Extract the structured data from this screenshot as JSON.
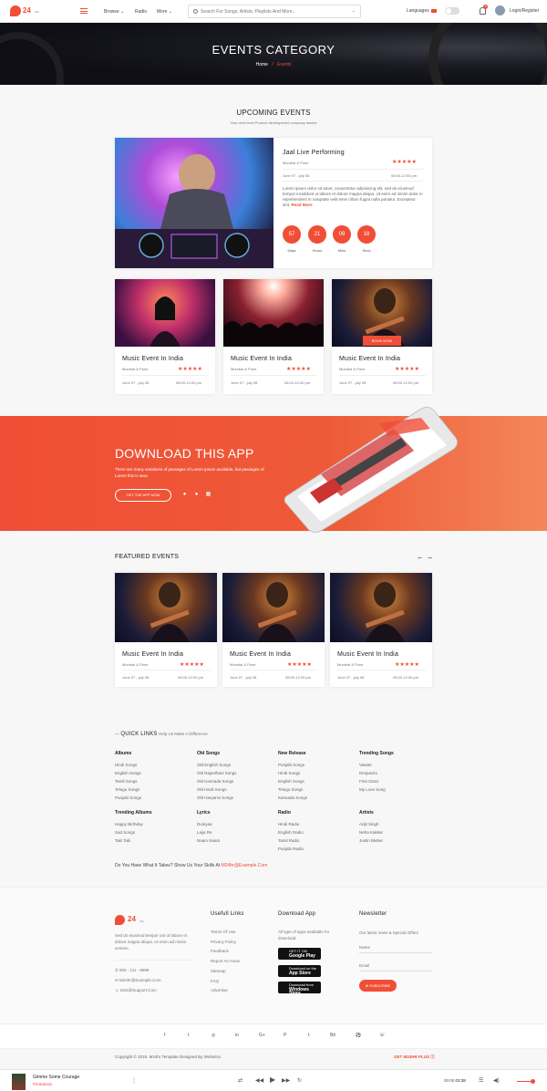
{
  "header": {
    "logo_text": "24",
    "logo_sub": "MB",
    "nav": [
      "Browse",
      "Radio",
      "More"
    ],
    "search_placeholder": "Search For Songs, Artists, Playlists And More..",
    "language": "Languages",
    "notifications": "2",
    "login": "Login/Register"
  },
  "banner": {
    "title": "EVENTS CATEGORY",
    "crumb_home": "Home",
    "crumb_sep": "/",
    "crumb_current": "Events"
  },
  "upcoming": {
    "title": "UPCOMING EVENTS",
    "subtitle": "Your next level Product developemnt company assets",
    "featured": {
      "title": "Jaal Live Performing",
      "location": "Mumbai & Pune",
      "dates": "June 07 - july 08",
      "time": "08:00-12:00 pm",
      "description": "Lorem ipsum dolor sit amet, consectetur adipisicing elit, sed do eiusmod tempor incididunt ut labore et dolore magna aliqua. Ut enim ad minim dolor in reprehenderit in voluptate velit esse cillum fugiat nulla pariatur. Excepteur sint.",
      "read_more": "Read More",
      "countdown": [
        {
          "value": "57",
          "label": "Days"
        },
        {
          "value": "21",
          "label": "Hours"
        },
        {
          "value": "09",
          "label": "Mins"
        },
        {
          "value": "18",
          "label": "Secs"
        }
      ]
    },
    "cards": [
      {
        "title": "Music Event In India",
        "location": "Mumbai & Pune",
        "dates": "June 07 - july 08",
        "time": "08:00-12:00 pm"
      },
      {
        "title": "Music Event In India",
        "location": "Mumbai & Pune",
        "dates": "June 07 - july 08",
        "time": "08:00-12:00 pm"
      },
      {
        "title": "Music Event In India",
        "location": "Mumbai & Pune",
        "dates": "June 07 - july 08",
        "time": "08:00-12:00 pm",
        "badge": "BOOK NOW"
      }
    ],
    "stars": "★★★★★"
  },
  "app": {
    "title": "DOWNLOAD THIS APP",
    "desc": "There are many variations of passages of Lorem Ipsum available, but passages of Lorem this is wow.",
    "button": "GET THE APP NOW"
  },
  "featured": {
    "title": "FEATURED EVENTS",
    "cards": [
      {
        "title": "Music Event In India",
        "location": "Mumbai & Pune",
        "dates": "June 07 - july 08",
        "time": "08:00-12:00 pm"
      },
      {
        "title": "Music Event In India",
        "location": "Mumbai & Pune",
        "dates": "June 07 - july 08",
        "time": "08:00-12:00 pm"
      },
      {
        "title": "Music Event In India",
        "location": "Mumbai & Pune",
        "dates": "June 07 - july 08",
        "time": "08:00-12:00 pm"
      }
    ]
  },
  "quicklinks": {
    "title": "QUICK LINKS",
    "subtitle": "Help Us Make A Difference.",
    "cols": [
      {
        "title": "Albums",
        "items": [
          "Hindi Songs",
          "English Songs",
          "Tamil Songs",
          "Telugu Songs",
          "Punjabi Songs"
        ]
      },
      {
        "title": "Old Songs",
        "items": [
          "Old English Songs",
          "Old Rajasthani Songs",
          "Old Kannada Songs",
          "Old Hindi Songs",
          "Old Haryanvi Songs"
        ]
      },
      {
        "title": "New Release",
        "items": [
          "Punjabi Songs",
          "Hindi Songs",
          "English Songs",
          "Telugu Songs",
          "Kannada Songs"
        ]
      },
      {
        "title": "Trending Songs",
        "items": [
          "Vaaste",
          "Despacito",
          "First Class",
          "My Love Song"
        ]
      },
      {
        "title": "Trending Albums",
        "items": [
          "Happy Birthday",
          "Sad Songs",
          "Taki Taki"
        ]
      },
      {
        "title": "Lyrics",
        "items": [
          "Duniyaa",
          "Laija Re",
          "Naam Naam"
        ]
      },
      {
        "title": "Radio",
        "items": [
          "Hindi Radio",
          "English Radio",
          "Tamil Radio",
          "Punjabi Radio"
        ]
      },
      {
        "title": "Artists",
        "items": [
          "Arijit Singh",
          "Neha Kakkar",
          "Justin Bieber"
        ]
      }
    ],
    "ask": "Do You Have What It Takes? Show Us Your Skills At",
    "ask_email": "M24hr@Example.Com"
  },
  "footer": {
    "about": "Sed do eiusmod tempor unt ut labore et dolore magna aliqua. Ut enim ad minim veniam.",
    "phone": "800 - 111 - 9999",
    "email1": "M24hr@Example.Com",
    "email2": "M24@Support.Com",
    "links_title": "Usefull Links",
    "links": [
      "Terms Of Use",
      "Privacy Policy",
      "Feedback",
      "Report An Issue",
      "Sitemap",
      "FAQ",
      "Advertise"
    ],
    "download_title": "Download App",
    "download_desc": "All type of apps available for download.",
    "stores": [
      {
        "small": "GET IT ON",
        "big": "Google Play"
      },
      {
        "small": "Download on the",
        "big": "App Store"
      },
      {
        "small": "Download from",
        "big": "Windows Store"
      }
    ],
    "newsletter_title": "Newsletter",
    "newsletter_desc": "Our latest news & Special Offers",
    "name_placeholder": "Name",
    "email_placeholder": "Email",
    "subscribe": "SUBSCRIBE"
  },
  "social": [
    "f",
    "t",
    "◎",
    "in",
    "G+",
    "P",
    "t",
    "Bē",
    "⚽",
    "☏"
  ],
  "copyright": "Copyright © 2019. M24hr Template Designed By Webstrot.",
  "get_plus": "GET M24HR PLUS",
  "player": {
    "title": "Gimme Some Courage",
    "artist": "Pentatonix",
    "time_current": "00:00",
    "time_total": "03:38",
    "volume": 0.8
  },
  "colors": {
    "accent": "#f04e36"
  }
}
